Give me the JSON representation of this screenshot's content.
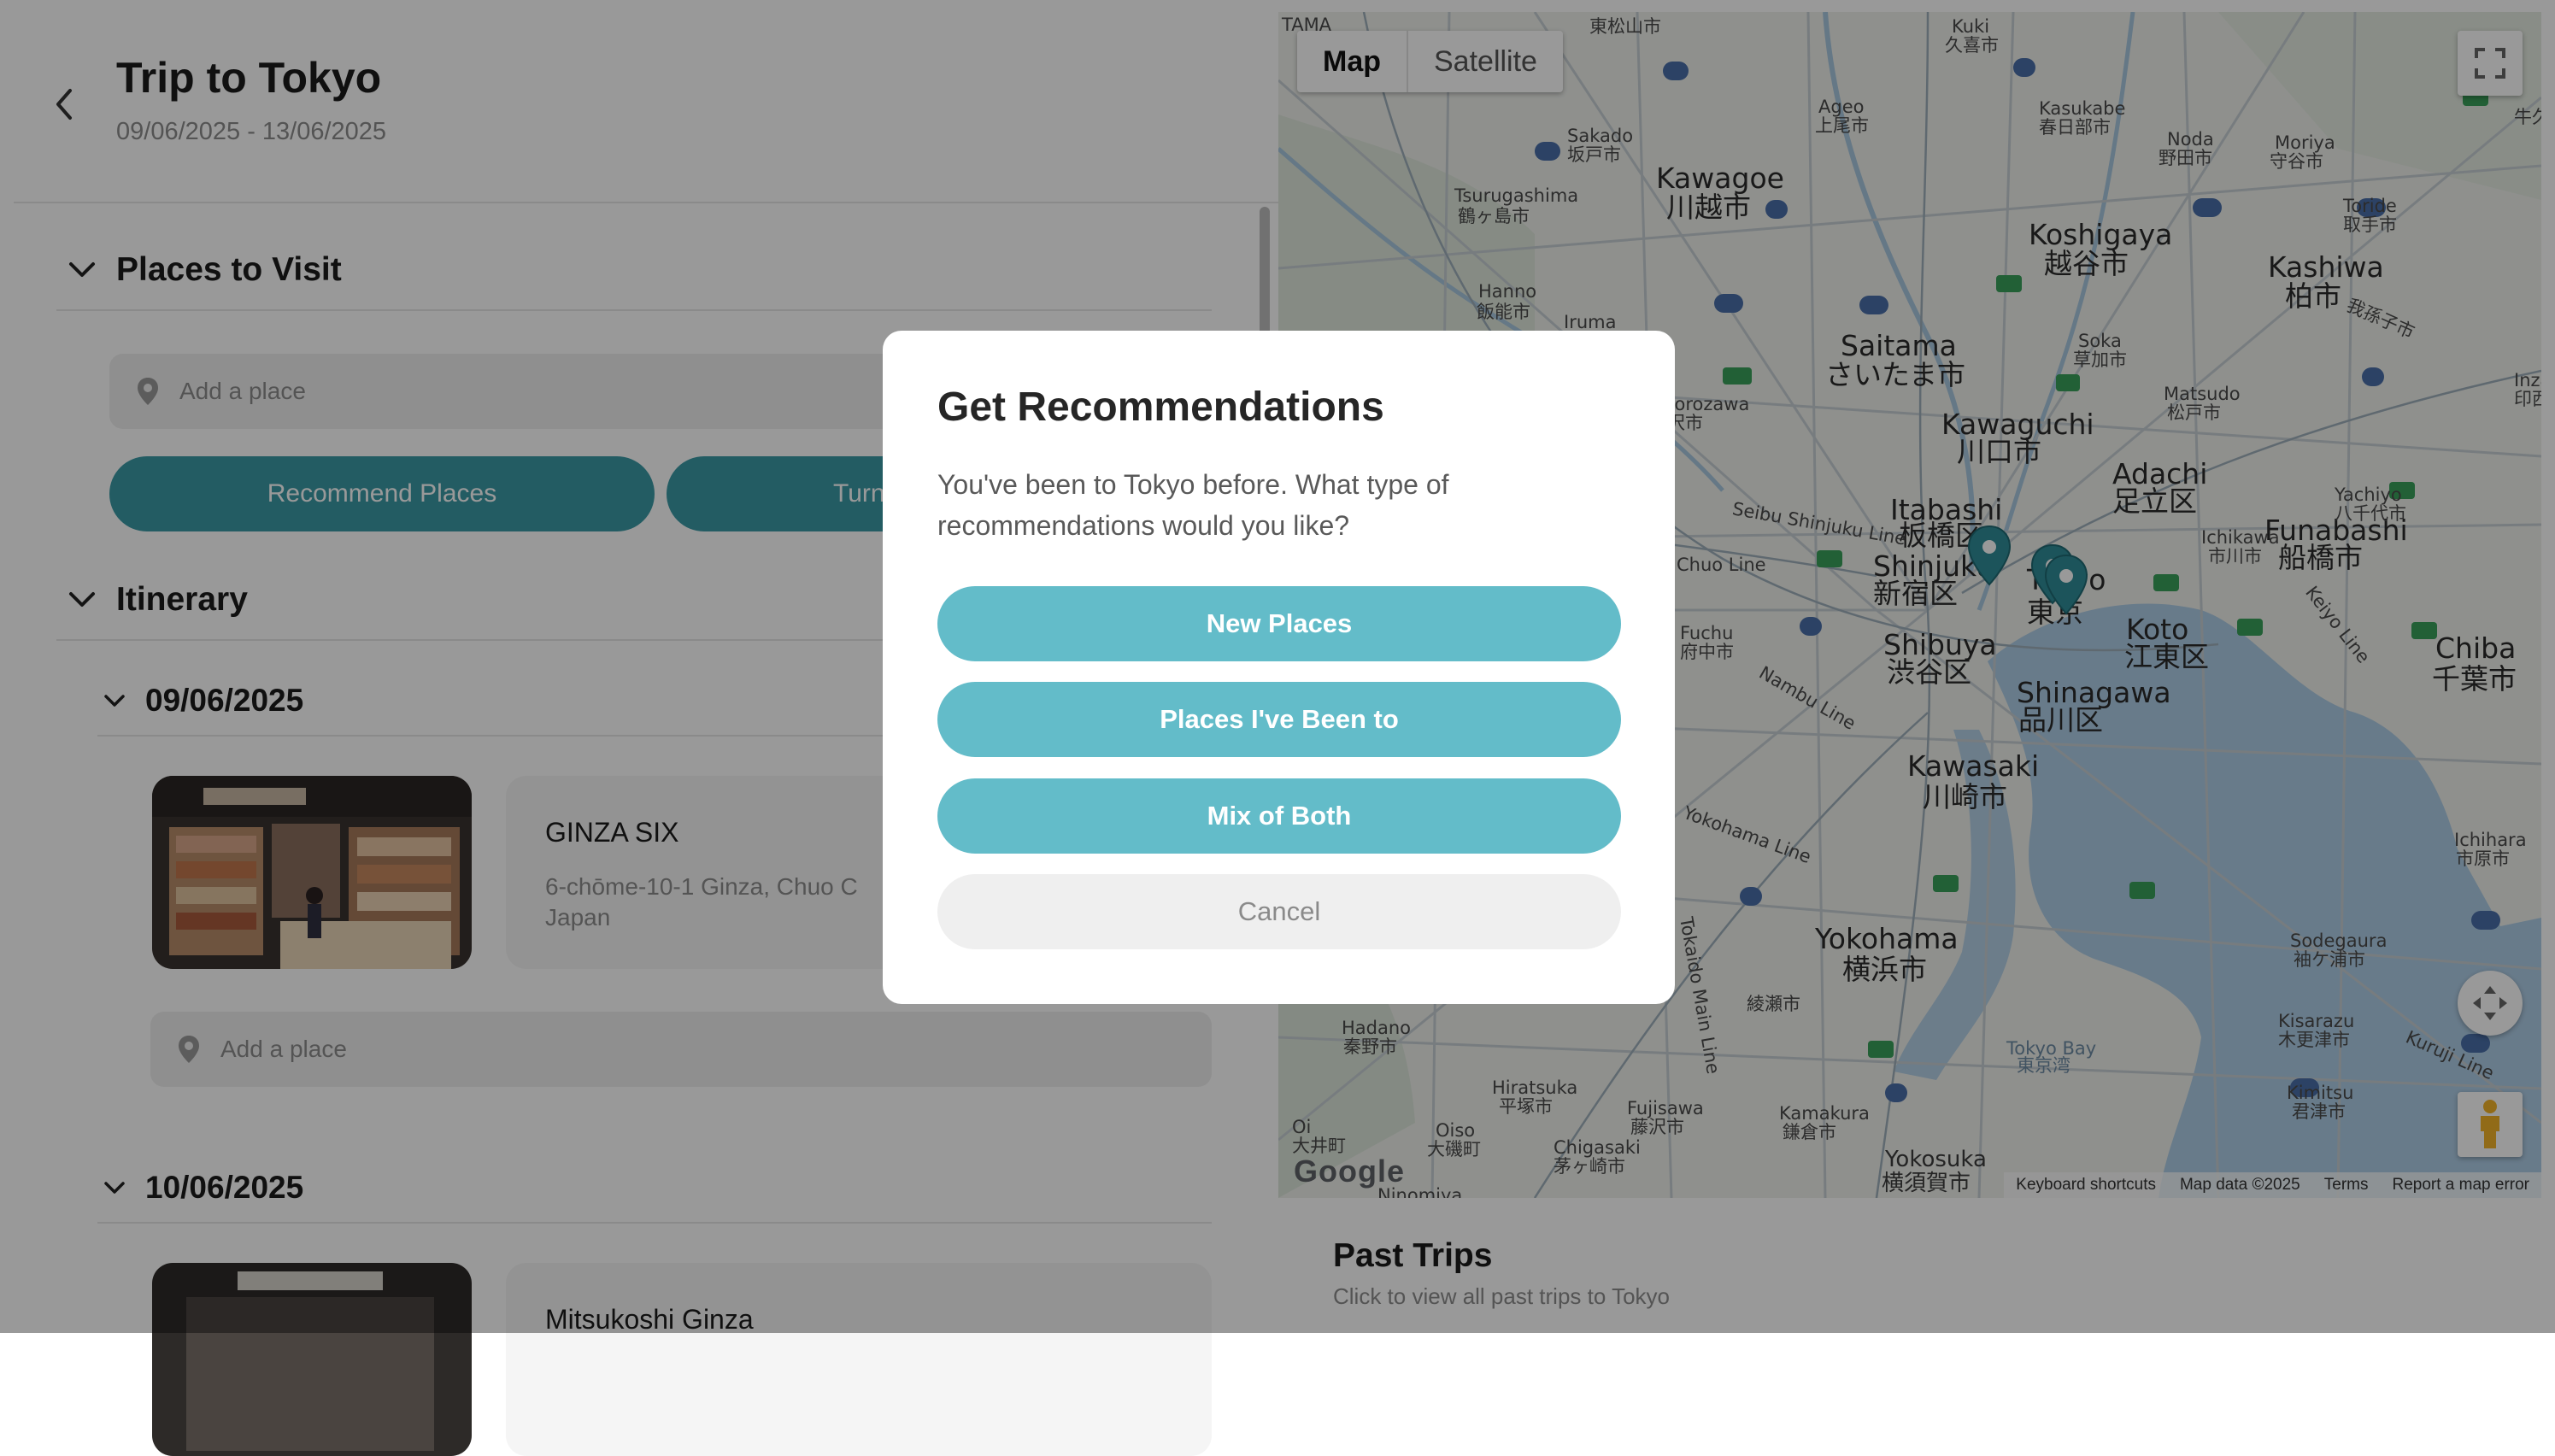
{
  "trip": {
    "title": "Trip to Tokyo",
    "dates": "09/06/2025 - 13/06/2025"
  },
  "places_section": {
    "title": "Places to Visit",
    "add_place_placeholder": "Add a place",
    "recommend_button": "Recommend Places",
    "second_button_visible": "Turn"
  },
  "itinerary": {
    "title": "Itinerary",
    "days": [
      {
        "date": "09/06/2025",
        "place": {
          "name": "GINZA SIX",
          "address": "6-chōme-10-1 Ginza, Chuo C",
          "address2": "Japan"
        },
        "add_place_placeholder": "Add a place"
      },
      {
        "date": "10/06/2025",
        "place": {
          "name": "Mitsukoshi Ginza"
        }
      }
    ]
  },
  "map": {
    "type_buttons": [
      "Map",
      "Satellite"
    ],
    "active_type": "Map",
    "logo": "Google",
    "footer": [
      "Keyboard shortcuts",
      "Map data ©2025",
      "Terms",
      "Report a map error"
    ],
    "labels": [
      {
        "t": "Kawagoe",
        "c": "big"
      },
      {
        "t": "川越市",
        "c": "big"
      },
      {
        "t": "Koshigaya",
        "c": "big"
      },
      {
        "t": "越谷市",
        "c": "big"
      },
      {
        "t": "Kashiwa",
        "c": "big"
      },
      {
        "t": "柏市",
        "c": "big"
      },
      {
        "t": "Saitama",
        "c": "big"
      },
      {
        "t": "さいたま市",
        "c": "big"
      },
      {
        "t": "Kawaguchi",
        "c": "big"
      },
      {
        "t": "川口市",
        "c": "big"
      },
      {
        "t": "Adachi",
        "c": "big"
      },
      {
        "t": "足立区",
        "c": "big"
      },
      {
        "t": "Itabashi",
        "c": "big"
      },
      {
        "t": "板橋区",
        "c": "big"
      },
      {
        "t": "Shinjuku",
        "c": "big"
      },
      {
        "t": "新宿区",
        "c": "big"
      },
      {
        "t": "Tokyo",
        "c": "big"
      },
      {
        "t": "東京",
        "c": "big"
      },
      {
        "t": "Funabashi",
        "c": "big"
      },
      {
        "t": "船橋市",
        "c": "big"
      },
      {
        "t": "Shibuya",
        "c": "big"
      },
      {
        "t": "渋谷区",
        "c": "big"
      },
      {
        "t": "Koto",
        "c": "big"
      },
      {
        "t": "江東区",
        "c": "big"
      },
      {
        "t": "Shinagawa",
        "c": "big"
      },
      {
        "t": "品川区",
        "c": "big"
      },
      {
        "t": "Chiba",
        "c": "big"
      },
      {
        "t": "千葉市",
        "c": "big"
      },
      {
        "t": "Kawasaki",
        "c": "big"
      },
      {
        "t": "川崎市",
        "c": "big"
      },
      {
        "t": "Yokohama",
        "c": "big"
      },
      {
        "t": "横浜市",
        "c": "big"
      },
      {
        "t": "Yokosuka",
        "c": "mid"
      },
      {
        "t": "横須賀市",
        "c": "mid"
      },
      {
        "t": "Tsurugashima",
        "c": "sm"
      },
      {
        "t": "鶴ヶ島市",
        "c": "sm"
      },
      {
        "t": "Hanno",
        "c": "sm"
      },
      {
        "t": "飯能市",
        "c": "sm"
      },
      {
        "t": "Sakado",
        "c": "sm"
      },
      {
        "t": "坂戸市",
        "c": "sm"
      },
      {
        "t": "Ageo",
        "c": "sm"
      },
      {
        "t": "上尾市",
        "c": "sm"
      },
      {
        "t": "Kasukabe",
        "c": "sm"
      },
      {
        "t": "春日部市",
        "c": "sm"
      },
      {
        "t": "Noda",
        "c": "sm"
      },
      {
        "t": "野田市",
        "c": "sm"
      },
      {
        "t": "Moriya",
        "c": "sm"
      },
      {
        "t": "守谷市",
        "c": "sm"
      },
      {
        "t": "Toride",
        "c": "sm"
      },
      {
        "t": "取手市",
        "c": "sm"
      },
      {
        "t": "Kuki",
        "c": "sm"
      },
      {
        "t": "久喜市",
        "c": "sm"
      },
      {
        "t": "Tokorozawa",
        "c": "sm"
      },
      {
        "t": "所沢市",
        "c": "sm"
      },
      {
        "t": "Soka",
        "c": "sm"
      },
      {
        "t": "草加市",
        "c": "sm"
      },
      {
        "t": "Matsudo",
        "c": "sm"
      },
      {
        "t": "松戸市",
        "c": "sm"
      },
      {
        "t": "Yachiyo",
        "c": "sm"
      },
      {
        "t": "八千代市",
        "c": "sm"
      },
      {
        "t": "Ichikawa",
        "c": "sm"
      },
      {
        "t": "市川市",
        "c": "sm"
      },
      {
        "t": "Chuo Line",
        "c": "sm"
      },
      {
        "t": "Seibu Shinjuku Line",
        "c": "sm"
      },
      {
        "t": "Ichihara",
        "c": "sm"
      },
      {
        "t": "市原市",
        "c": "sm"
      },
      {
        "t": "Sodegaura",
        "c": "sm"
      },
      {
        "t": "袖ケ浦市",
        "c": "sm"
      },
      {
        "t": "Kisarazu",
        "c": "sm"
      },
      {
        "t": "木更津市",
        "c": "sm"
      },
      {
        "t": "Kimitsu",
        "c": "sm"
      },
      {
        "t": "君津市",
        "c": "sm"
      },
      {
        "t": "Tokyo Bay",
        "c": "sm"
      },
      {
        "t": "東京湾",
        "c": "sm"
      },
      {
        "t": "Hadano",
        "c": "sm"
      },
      {
        "t": "秦野市",
        "c": "sm"
      },
      {
        "t": "Hiratsuka",
        "c": "sm"
      },
      {
        "t": "平塚市",
        "c": "sm"
      },
      {
        "t": "Fujisawa",
        "c": "sm"
      },
      {
        "t": "藤沢市",
        "c": "sm"
      },
      {
        "t": "Kamakura",
        "c": "sm"
      },
      {
        "t": "鎌倉市",
        "c": "sm"
      },
      {
        "t": "Chigasaki",
        "c": "sm"
      },
      {
        "t": "茅ヶ崎市",
        "c": "sm"
      },
      {
        "t": "Oiso",
        "c": "sm"
      },
      {
        "t": "大磯町",
        "c": "sm"
      },
      {
        "t": "Oi",
        "c": "sm"
      },
      {
        "t": "大井町",
        "c": "sm"
      },
      {
        "t": "Fuchu",
        "c": "sm"
      },
      {
        "t": "府中市",
        "c": "sm"
      },
      {
        "t": "Iruma",
        "c": "sm"
      },
      {
        "t": "我孫子市",
        "c": "sm"
      },
      {
        "t": "Inza",
        "c": "sm"
      },
      {
        "t": "印西",
        "c": "sm"
      },
      {
        "t": "Kuruji Line",
        "c": "sm"
      },
      {
        "t": "Keiyo Line",
        "c": "sm"
      },
      {
        "t": "Nambu Line",
        "c": "sm"
      },
      {
        "t": "Yokohama Line",
        "c": "sm"
      },
      {
        "t": "Tokaido Main Line",
        "c": "sm"
      },
      {
        "t": "Ninomiya",
        "c": "sm"
      },
      {
        "t": "TAMA",
        "c": "sm"
      },
      {
        "t": "東松山市",
        "c": "sm"
      },
      {
        "t": "牛久",
        "c": "sm"
      },
      {
        "t": "綾瀬市",
        "c": "sm"
      }
    ]
  },
  "past_trips": {
    "title": "Past Trips",
    "subtitle": "Click to view all past trips to Tokyo"
  },
  "modal": {
    "title": "Get Recommendations",
    "body": "You've been to Tokyo before. What type of recommendations would you like?",
    "buttons": {
      "new": "New Places",
      "been": "Places I've Been to",
      "mix": "Mix of Both",
      "cancel": "Cancel"
    }
  },
  "colors": {
    "teal": "#3b9aa6",
    "modal_teal": "#63bcc9",
    "pin": "#2f8d98"
  }
}
